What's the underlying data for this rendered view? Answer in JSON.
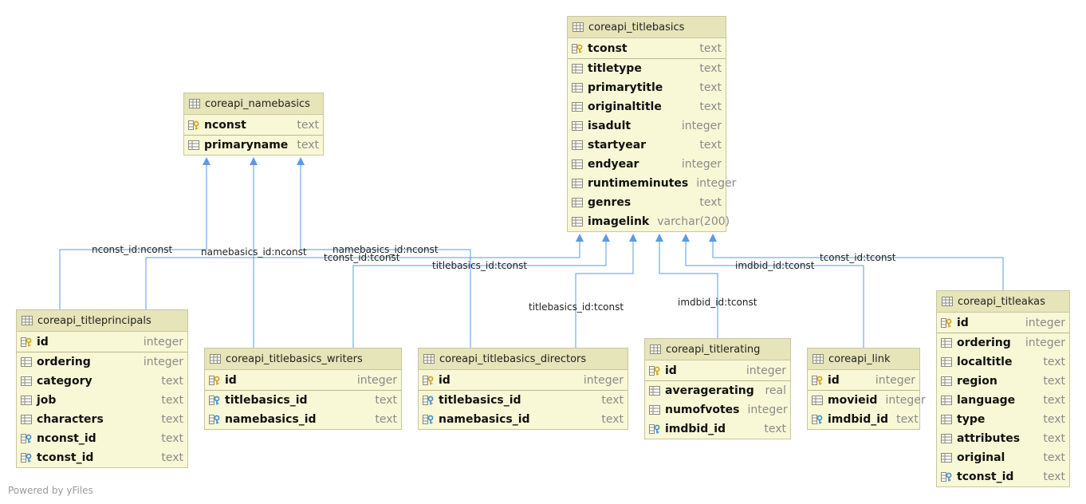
{
  "tables": {
    "titlebasics": {
      "title": "coreapi_titlebasics",
      "pk": [
        {
          "name": "tconst",
          "type": "text",
          "icon": "primary-key-icon"
        }
      ],
      "cols": [
        {
          "name": "titletype",
          "type": "text",
          "icon": "column-icon"
        },
        {
          "name": "primarytitle",
          "type": "text",
          "icon": "column-icon"
        },
        {
          "name": "originaltitle",
          "type": "text",
          "icon": "column-icon"
        },
        {
          "name": "isadult",
          "type": "integer",
          "icon": "column-icon"
        },
        {
          "name": "startyear",
          "type": "text",
          "icon": "column-icon"
        },
        {
          "name": "endyear",
          "type": "integer",
          "icon": "column-icon"
        },
        {
          "name": "runtimeminutes",
          "type": "integer",
          "icon": "column-icon"
        },
        {
          "name": "genres",
          "type": "text",
          "icon": "column-icon"
        },
        {
          "name": "imagelink",
          "type": "varchar(200)",
          "icon": "column-icon"
        }
      ]
    },
    "namebasics": {
      "title": "coreapi_namebasics",
      "pk": [
        {
          "name": "nconst",
          "type": "text",
          "icon": "primary-key-icon"
        }
      ],
      "cols": [
        {
          "name": "primaryname",
          "type": "text",
          "icon": "column-icon"
        }
      ]
    },
    "titleprincipals": {
      "title": "coreapi_titleprincipals",
      "pk": [
        {
          "name": "id",
          "type": "integer",
          "icon": "primary-key-icon"
        }
      ],
      "cols": [
        {
          "name": "ordering",
          "type": "integer",
          "icon": "column-icon"
        },
        {
          "name": "category",
          "type": "text",
          "icon": "column-icon"
        },
        {
          "name": "job",
          "type": "text",
          "icon": "column-icon"
        },
        {
          "name": "characters",
          "type": "text",
          "icon": "column-icon"
        },
        {
          "name": "nconst_id",
          "type": "text",
          "icon": "foreign-key-icon"
        },
        {
          "name": "tconst_id",
          "type": "text",
          "icon": "foreign-key-icon"
        }
      ]
    },
    "writers": {
      "title": "coreapi_titlebasics_writers",
      "pk": [
        {
          "name": "id",
          "type": "integer",
          "icon": "primary-key-icon"
        }
      ],
      "cols": [
        {
          "name": "titlebasics_id",
          "type": "text",
          "icon": "foreign-key-icon"
        },
        {
          "name": "namebasics_id",
          "type": "text",
          "icon": "foreign-key-icon"
        }
      ]
    },
    "directors": {
      "title": "coreapi_titlebasics_directors",
      "pk": [
        {
          "name": "id",
          "type": "integer",
          "icon": "primary-key-icon"
        }
      ],
      "cols": [
        {
          "name": "titlebasics_id",
          "type": "text",
          "icon": "foreign-key-icon"
        },
        {
          "name": "namebasics_id",
          "type": "text",
          "icon": "foreign-key-icon"
        }
      ]
    },
    "titlerating": {
      "title": "coreapi_titlerating",
      "pk": [
        {
          "name": "id",
          "type": "integer",
          "icon": "primary-key-icon"
        }
      ],
      "cols": [
        {
          "name": "averagerating",
          "type": "real",
          "icon": "column-icon"
        },
        {
          "name": "numofvotes",
          "type": "integer",
          "icon": "column-icon"
        },
        {
          "name": "imdbid_id",
          "type": "text",
          "icon": "foreign-key-icon"
        }
      ]
    },
    "link": {
      "title": "coreapi_link",
      "pk": [
        {
          "name": "id",
          "type": "integer",
          "icon": "primary-key-icon"
        }
      ],
      "cols": [
        {
          "name": "movieid",
          "type": "integer",
          "icon": "column-icon"
        },
        {
          "name": "imdbid_id",
          "type": "text",
          "icon": "foreign-key-icon"
        }
      ]
    },
    "titleakas": {
      "title": "coreapi_titleakas",
      "pk": [
        {
          "name": "id",
          "type": "integer",
          "icon": "primary-key-icon"
        }
      ],
      "cols": [
        {
          "name": "ordering",
          "type": "integer",
          "icon": "column-icon"
        },
        {
          "name": "localtitle",
          "type": "text",
          "icon": "column-icon"
        },
        {
          "name": "region",
          "type": "text",
          "icon": "column-icon"
        },
        {
          "name": "language",
          "type": "text",
          "icon": "column-icon"
        },
        {
          "name": "type",
          "type": "text",
          "icon": "column-icon"
        },
        {
          "name": "attributes",
          "type": "text",
          "icon": "column-icon"
        },
        {
          "name": "original",
          "type": "text",
          "icon": "column-icon"
        },
        {
          "name": "tconst_id",
          "type": "text",
          "icon": "foreign-key-icon"
        }
      ]
    }
  },
  "relations": {
    "r1": "nconst_id:nconst",
    "r2": "namebasics_id:nconst",
    "r3": "namebasics_id:nconst",
    "r4": "tconst_id:tconst",
    "r5": "titlebasics_id:tconst",
    "r6": "titlebasics_id:tconst",
    "r7": "imdbid_id:tconst",
    "r8": "imdbid_id:tconst",
    "r9": "tconst_id:tconst"
  },
  "footer": "Powered by yFiles",
  "colors": {
    "edge": "#5a9ae6",
    "header": "#e6e4b9",
    "body": "#f9f8d6"
  }
}
